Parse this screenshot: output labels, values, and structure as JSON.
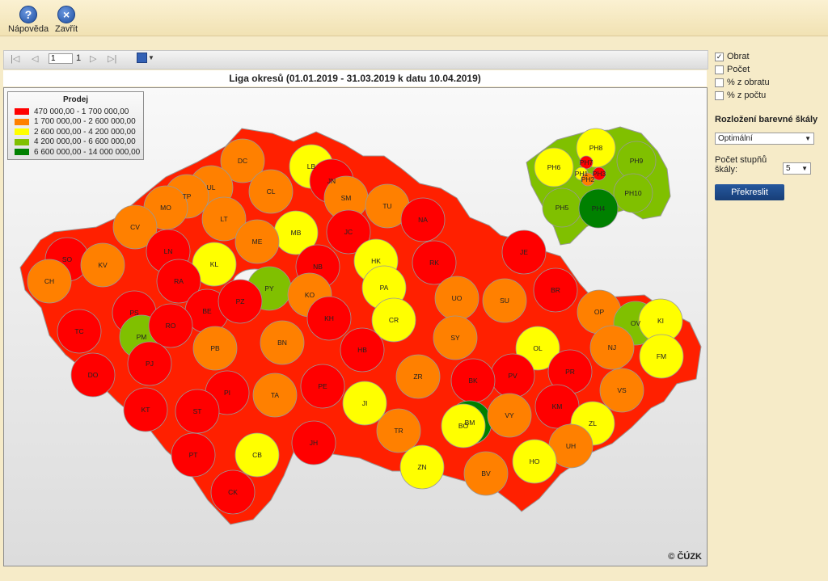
{
  "toolbar": {
    "help_label": "Nápověda",
    "close_label": "Zavřít"
  },
  "pager": {
    "current_page": "1",
    "total_pages": "1"
  },
  "report": {
    "title": "Liga okresů (01.01.2019 - 31.03.2019 k datu 10.04.2019)",
    "copyright": "© ČÚZK"
  },
  "legend": {
    "title": "Prodej",
    "items": [
      {
        "label": "470 000,00 - 1 700 000,00",
        "color": "#ff0000"
      },
      {
        "label": "1 700 000,00 - 2 600 000,00",
        "color": "#ff8000"
      },
      {
        "label": "2 600 000,00 - 4 200 000,00",
        "color": "#ffff00"
      },
      {
        "label": "4 200 000,00 - 6 600 000,00",
        "color": "#80c000"
      },
      {
        "label": "6 600 000,00 - 14 000 000,00",
        "color": "#008000"
      }
    ]
  },
  "options": {
    "obrat": "Obrat",
    "pocet": "Počet",
    "pct_obrat": "% z obratu",
    "pct_pocet": "% z počtu",
    "obrat_checked": true
  },
  "scale": {
    "title": "Rozložení barevné škály",
    "distribution_value": "Optimální",
    "steps_label": "Počet stupňů škály:",
    "steps_value": "5",
    "redraw_label": "Překreslit"
  },
  "districts": [
    {
      "code": "DC",
      "cat": 1
    },
    {
      "code": "LB",
      "cat": 2
    },
    {
      "code": "JN",
      "cat": 0
    },
    {
      "code": "CL",
      "cat": 1
    },
    {
      "code": "UL",
      "cat": 1
    },
    {
      "code": "TP",
      "cat": 1
    },
    {
      "code": "MO",
      "cat": 1
    },
    {
      "code": "LT",
      "cat": 1
    },
    {
      "code": "CV",
      "cat": 1
    },
    {
      "code": "SM",
      "cat": 1
    },
    {
      "code": "TU",
      "cat": 1
    },
    {
      "code": "NA",
      "cat": 0
    },
    {
      "code": "MB",
      "cat": 2
    },
    {
      "code": "JC",
      "cat": 0
    },
    {
      "code": "ME",
      "cat": 1
    },
    {
      "code": "SO",
      "cat": 0
    },
    {
      "code": "KV",
      "cat": 1
    },
    {
      "code": "CH",
      "cat": 1
    },
    {
      "code": "LN",
      "cat": 0
    },
    {
      "code": "KL",
      "cat": 2
    },
    {
      "code": "NB",
      "cat": 0
    },
    {
      "code": "HK",
      "cat": 2
    },
    {
      "code": "RK",
      "cat": 0
    },
    {
      "code": "JE",
      "cat": 0
    },
    {
      "code": "RA",
      "cat": 0
    },
    {
      "code": "PY",
      "cat": 3
    },
    {
      "code": "PA",
      "cat": 2
    },
    {
      "code": "KO",
      "cat": 1
    },
    {
      "code": "UO",
      "cat": 1
    },
    {
      "code": "SU",
      "cat": 1
    },
    {
      "code": "BR",
      "cat": 0
    },
    {
      "code": "PS",
      "cat": 0
    },
    {
      "code": "BE",
      "cat": 0
    },
    {
      "code": "PZ",
      "cat": 0
    },
    {
      "code": "KH",
      "cat": 0
    },
    {
      "code": "CR",
      "cat": 2
    },
    {
      "code": "OP",
      "cat": 1
    },
    {
      "code": "OV",
      "cat": 3
    },
    {
      "code": "KI",
      "cat": 2
    },
    {
      "code": "TC",
      "cat": 0
    },
    {
      "code": "PM",
      "cat": 3
    },
    {
      "code": "RO",
      "cat": 0
    },
    {
      "code": "PB",
      "cat": 1
    },
    {
      "code": "BN",
      "cat": 1
    },
    {
      "code": "HB",
      "cat": 0
    },
    {
      "code": "SY",
      "cat": 1
    },
    {
      "code": "OL",
      "cat": 2
    },
    {
      "code": "NJ",
      "cat": 1
    },
    {
      "code": "FM",
      "cat": 2
    },
    {
      "code": "DO",
      "cat": 0
    },
    {
      "code": "PJ",
      "cat": 0
    },
    {
      "code": "PV",
      "cat": 0
    },
    {
      "code": "PR",
      "cat": 0
    },
    {
      "code": "VS",
      "cat": 1
    },
    {
      "code": "PI",
      "cat": 0
    },
    {
      "code": "TA",
      "cat": 1
    },
    {
      "code": "PE",
      "cat": 0
    },
    {
      "code": "ZR",
      "cat": 1
    },
    {
      "code": "BK",
      "cat": 0
    },
    {
      "code": "KT",
      "cat": 0
    },
    {
      "code": "ST",
      "cat": 0
    },
    {
      "code": "JI",
      "cat": 2
    },
    {
      "code": "BM",
      "cat": 4
    },
    {
      "code": "BO",
      "cat": 2
    },
    {
      "code": "VY",
      "cat": 1
    },
    {
      "code": "KM",
      "cat": 0
    },
    {
      "code": "ZL",
      "cat": 2
    },
    {
      "code": "TR",
      "cat": 1
    },
    {
      "code": "UH",
      "cat": 1
    },
    {
      "code": "CB",
      "cat": 2
    },
    {
      "code": "JH",
      "cat": 0
    },
    {
      "code": "PT",
      "cat": 0
    },
    {
      "code": "ZN",
      "cat": 2
    },
    {
      "code": "HO",
      "cat": 2
    },
    {
      "code": "BV",
      "cat": 1
    },
    {
      "code": "CK",
      "cat": 0
    },
    {
      "code": "PH8",
      "cat": 2
    },
    {
      "code": "PH7",
      "cat": 0
    },
    {
      "code": "PH6",
      "cat": 2
    },
    {
      "code": "PH1",
      "cat": 2
    },
    {
      "code": "PH3",
      "cat": 0
    },
    {
      "code": "PH2",
      "cat": 1
    },
    {
      "code": "PH9",
      "cat": 3
    },
    {
      "code": "PH5",
      "cat": 3
    },
    {
      "code": "PH10",
      "cat": 3
    },
    {
      "code": "PH4",
      "cat": 4
    }
  ]
}
